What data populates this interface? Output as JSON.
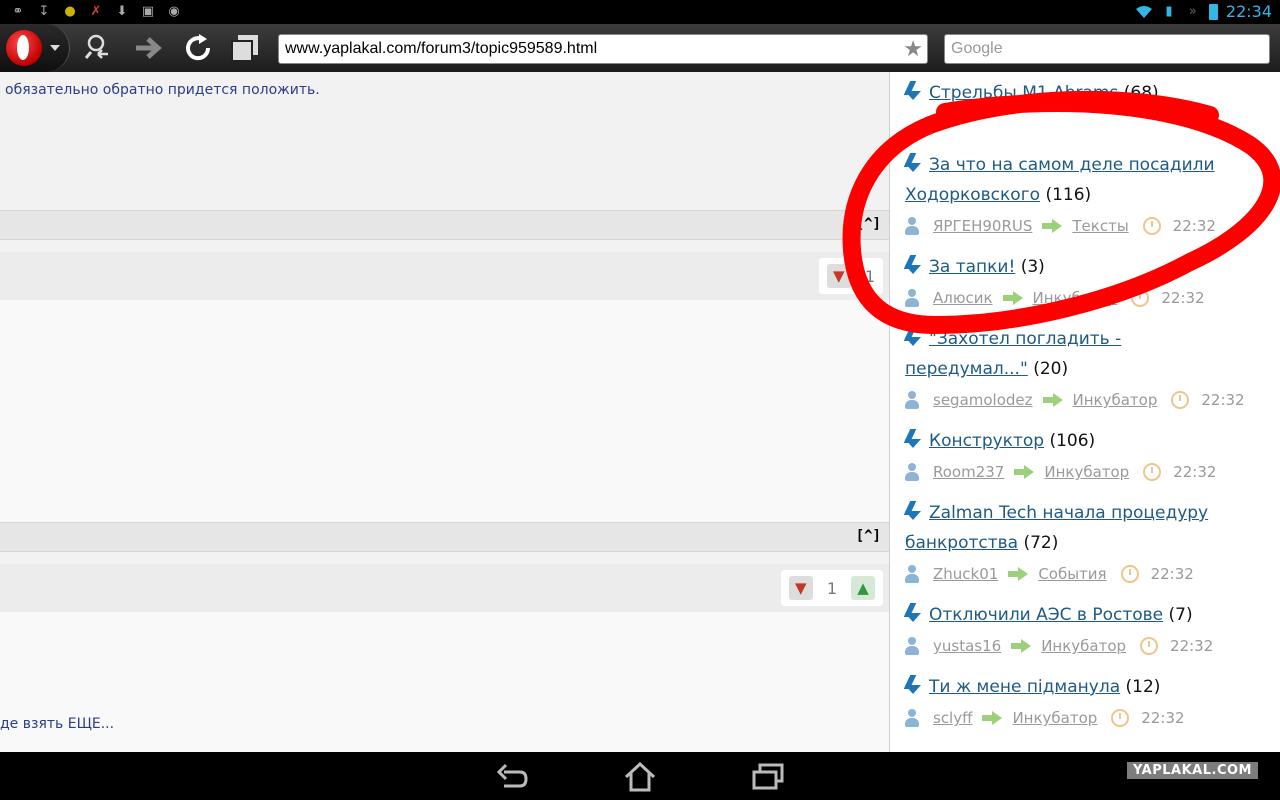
{
  "status_bar": {
    "time": "22:34",
    "left_icons": [
      "headphones-icon",
      "download-tray-icon",
      "app-icon",
      "disabled-app-icon",
      "download-icon",
      "photo-icon",
      "camera-icon"
    ],
    "accent_color": "#33b5e5"
  },
  "browser": {
    "url": "www.yaplakal.com/forum3/topic959589.html",
    "search_placeholder": "Google"
  },
  "left_pane": {
    "post_text_top": "обязательно обратно придется положить.",
    "up_label": "[^]",
    "posts": [
      {
        "rating": "1"
      },
      {
        "rating": "1"
      }
    ],
    "post_text_bottom": "де взять ЕЩЕ..."
  },
  "right_pane": {
    "topics": [
      {
        "title": "Стрельбы M1 Abrams",
        "count": "(68)"
      },
      {
        "title_line1": "За что на самом деле посадили",
        "title_line2": "Ходорковского",
        "count": "(116)",
        "author": "ЯРГЕН90RUS",
        "section": "Тексты",
        "time": "22:32"
      },
      {
        "title": "За тапки!",
        "count": "(3)",
        "author": "Алюсик",
        "section": "Инкубатор",
        "time": "22:32"
      },
      {
        "title_line1": "\"Захотел погладить -",
        "title_line2": "передумал...\"",
        "count": "(20)",
        "author": "segamolodez",
        "section": "Инкубатор",
        "time": "22:32"
      },
      {
        "title": "Конструктор",
        "count": "(106)",
        "author": "Room237",
        "section": "Инкубатор",
        "time": "22:32"
      },
      {
        "title_line1": "Zalman Tech начала процедуру",
        "title_line2": "банкротства",
        "count": "(72)",
        "author": "Zhuck01",
        "section": "События",
        "time": "22:32"
      },
      {
        "title": "Отключили АЭС в Ростове",
        "count": "(7)",
        "author": "yustas16",
        "section": "Инкубатор",
        "time": "22:32"
      },
      {
        "title": "Ти ж мене підманула",
        "count": "(12)",
        "author": "sclyff",
        "section": "Инкубатор",
        "time": "22:32"
      }
    ]
  },
  "watermark": "YAPLAKAL.COM",
  "colors": {
    "link": "#1e5a84",
    "post_text": "#2c3d86",
    "marker": "#ff0000"
  }
}
